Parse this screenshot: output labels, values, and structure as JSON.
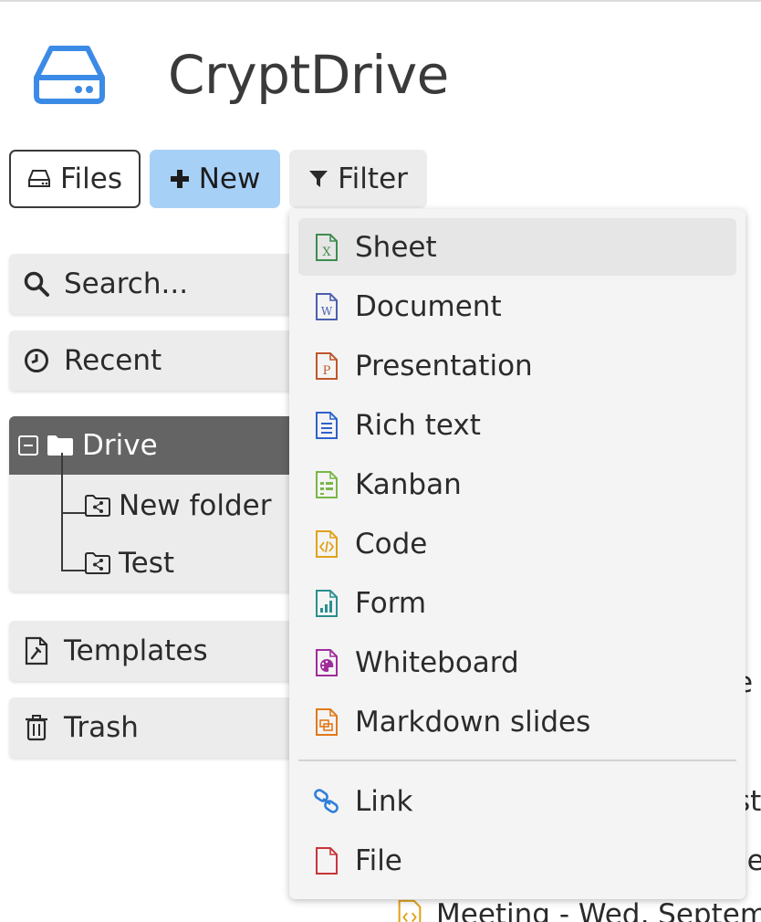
{
  "app": {
    "title": "CryptDrive"
  },
  "toolbar": {
    "files_label": "Files",
    "new_label": "New",
    "filter_label": "Filter"
  },
  "sidebar": {
    "search_placeholder": "Search...",
    "recent_label": "Recent",
    "drive": {
      "label": "Drive",
      "children": [
        "New folder",
        "Test"
      ]
    },
    "templates_label": "Templates",
    "trash_label": "Trash"
  },
  "new_menu": {
    "items": [
      {
        "label": "Sheet",
        "icon": "sheet-icon",
        "color": "#3d8c4f"
      },
      {
        "label": "Document",
        "icon": "document-icon",
        "color": "#4a5fb0"
      },
      {
        "label": "Presentation",
        "icon": "presentation-icon",
        "color": "#c0562a"
      },
      {
        "label": "Rich text",
        "icon": "rich-text-icon",
        "color": "#2f62c9"
      },
      {
        "label": "Kanban",
        "icon": "kanban-icon",
        "color": "#7ab648"
      },
      {
        "label": "Code",
        "icon": "code-icon",
        "color": "#e0a21b"
      },
      {
        "label": "Form",
        "icon": "form-icon",
        "color": "#2a8f8f"
      },
      {
        "label": "Whiteboard",
        "icon": "whiteboard-icon",
        "color": "#a02c9b"
      },
      {
        "label": "Markdown slides",
        "icon": "markdown-slides-icon",
        "color": "#e07a1b"
      }
    ],
    "extra_items": [
      {
        "label": "Link",
        "icon": "link-icon",
        "color": "#2f7fd9"
      },
      {
        "label": "File",
        "icon": "file-icon",
        "color": "#c8343b"
      }
    ]
  },
  "background": {
    "partial_text_1": "e",
    "partial_text_2": "st",
    "partial_text_3": "le",
    "partial_row": "Meeting - Wed, Septemb"
  },
  "colors": {
    "accent_new_button": "#a7d0f7",
    "drive_selected": "#646464",
    "logo": "#3b8be6"
  }
}
